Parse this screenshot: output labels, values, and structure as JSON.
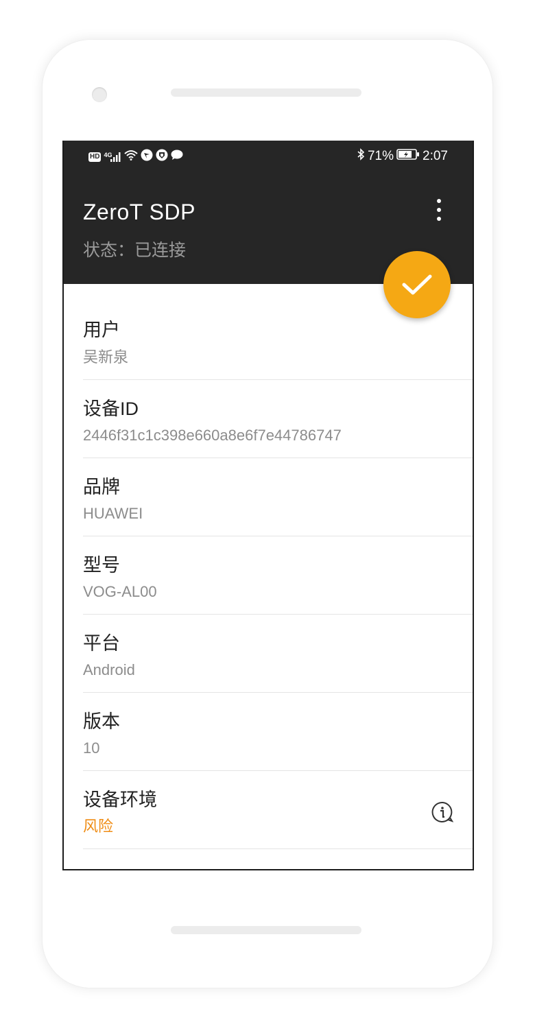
{
  "status_bar": {
    "left_icons": [
      "hd-icon",
      "signal-4g-icon",
      "wifi-icon",
      "app-notification-icon",
      "shield-notification-icon",
      "message-icon"
    ],
    "network_label": "4G",
    "hd_label": "HD",
    "battery": "71%",
    "time": "2:07"
  },
  "app_bar": {
    "title": "ZeroT SDP",
    "status": "状态：已连接",
    "menu_icon": "more-vert-icon"
  },
  "fab": {
    "icon": "check-icon",
    "color": "#f5a814"
  },
  "details": [
    {
      "label": "用户",
      "value": "吴新泉"
    },
    {
      "label": "设备ID",
      "value": "2446f31c1c398e660a8e6f7e44786747"
    },
    {
      "label": "品牌",
      "value": "HUAWEI"
    },
    {
      "label": "型号",
      "value": "VOG-AL00"
    },
    {
      "label": "平台",
      "value": "Android"
    },
    {
      "label": "版本",
      "value": "10"
    },
    {
      "label": "设备环境",
      "value": "风险",
      "value_color": "#ef8c14",
      "icon": "info-icon"
    }
  ]
}
